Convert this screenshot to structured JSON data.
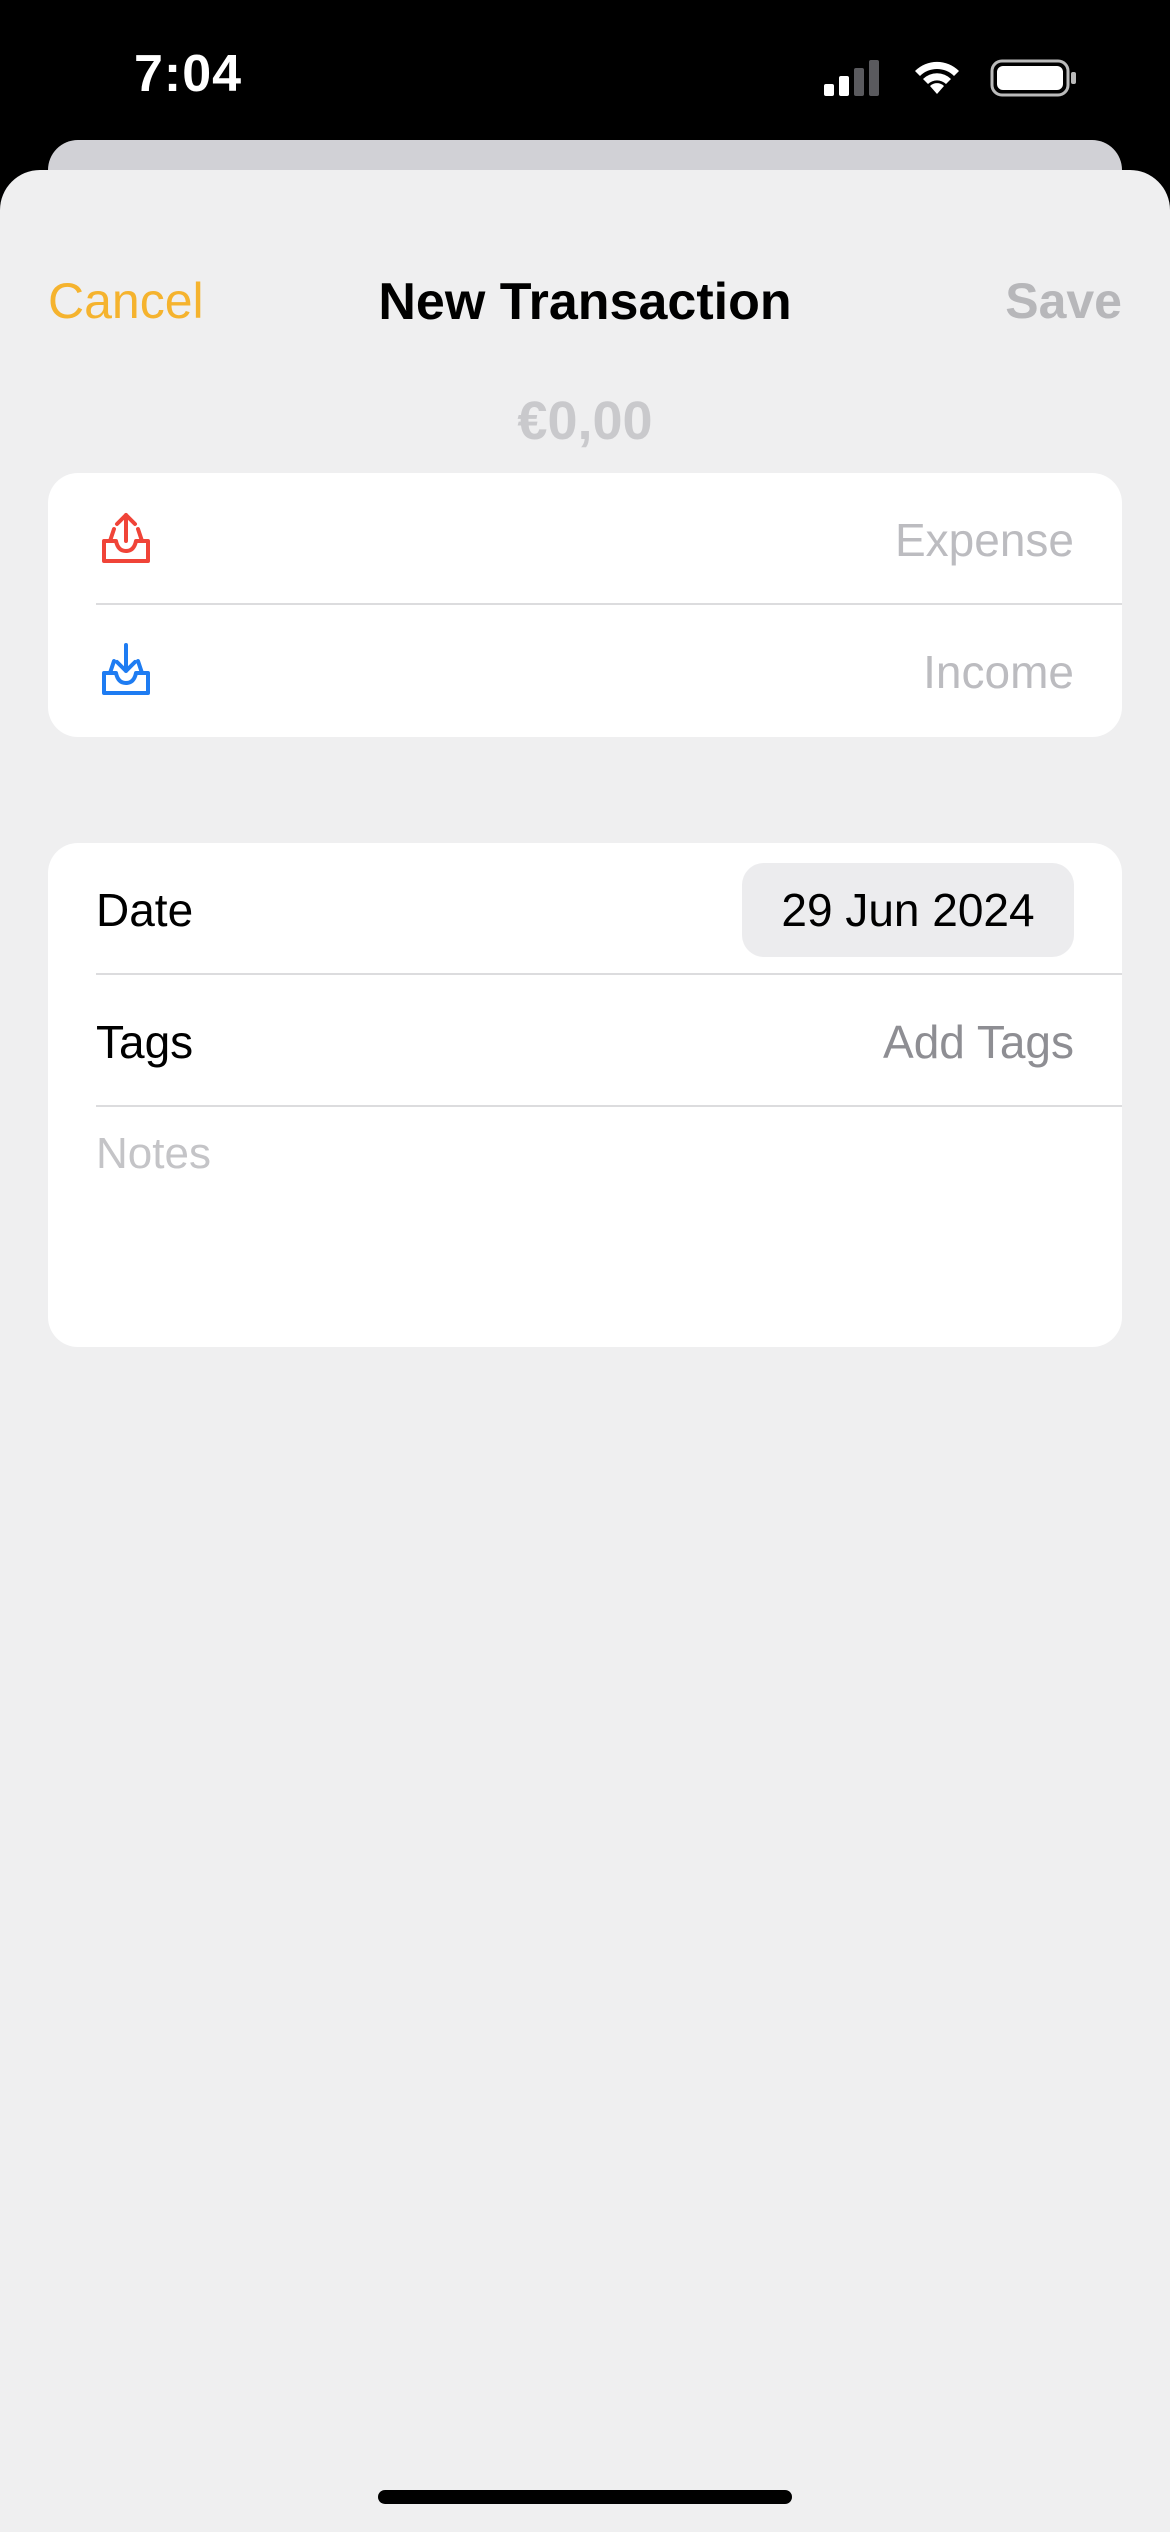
{
  "status_bar": {
    "time": "7:04",
    "icons": [
      "signal-icon",
      "wifi-icon",
      "battery-icon"
    ]
  },
  "nav": {
    "cancel_label": "Cancel",
    "title": "New Transaction",
    "save_label": "Save"
  },
  "amount": "€0,00",
  "transaction_types": [
    {
      "label": "Expense",
      "icon": "tray-upload-icon",
      "color": "#f04438"
    },
    {
      "label": "Income",
      "icon": "tray-download-icon",
      "color": "#1e7cf2"
    }
  ],
  "details": {
    "date_label": "Date",
    "date_value": "29 Jun 2024",
    "tags_label": "Tags",
    "tags_value": "Add Tags",
    "notes_placeholder": "Notes"
  },
  "colors": {
    "accent": "#f5b32e",
    "background": "#efeff0",
    "card": "#ffffff"
  }
}
